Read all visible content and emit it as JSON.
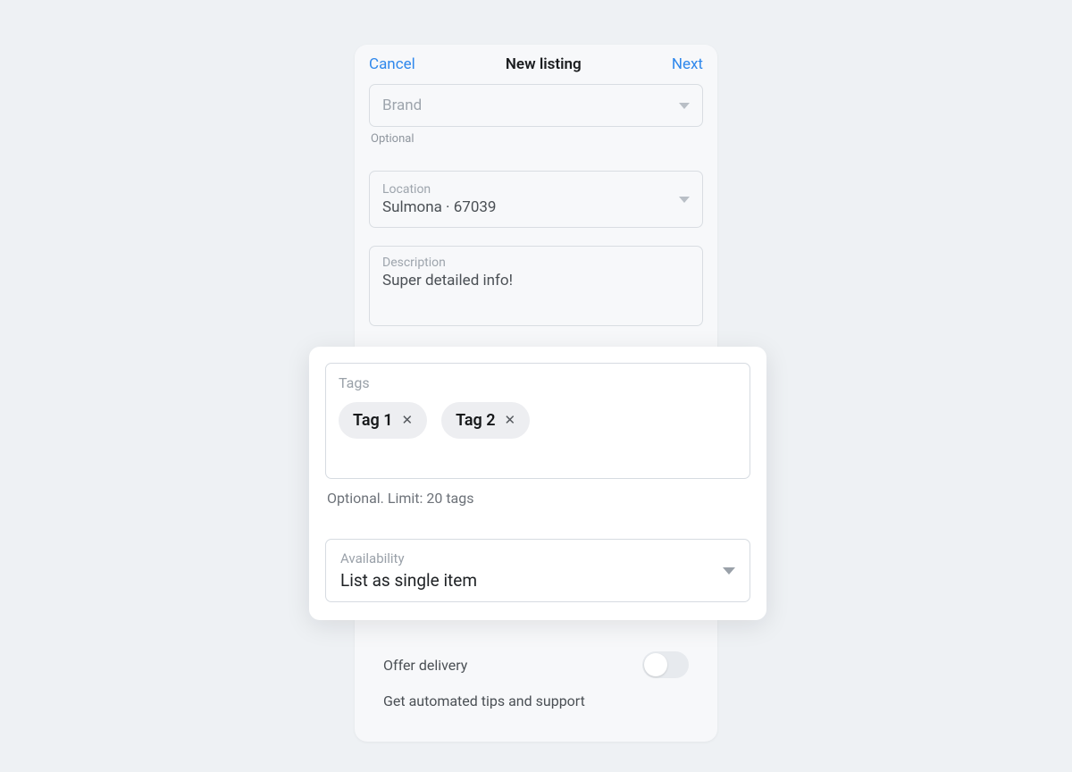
{
  "header": {
    "cancel": "Cancel",
    "title": "New listing",
    "next": "Next"
  },
  "brand": {
    "placeholder": "Brand",
    "helper": "Optional"
  },
  "location": {
    "label": "Location",
    "value": "Sulmona · 67039"
  },
  "description": {
    "label": "Description",
    "value": "Super detailed info!"
  },
  "tags": {
    "label": "Tags",
    "items": [
      "Tag 1",
      "Tag 2"
    ],
    "helper": "Optional. Limit: 20 tags"
  },
  "availability": {
    "label": "Availability",
    "value": "List as single item"
  },
  "options": {
    "offer_delivery": "Offer delivery",
    "auto_tips": "Get automated tips and support"
  }
}
